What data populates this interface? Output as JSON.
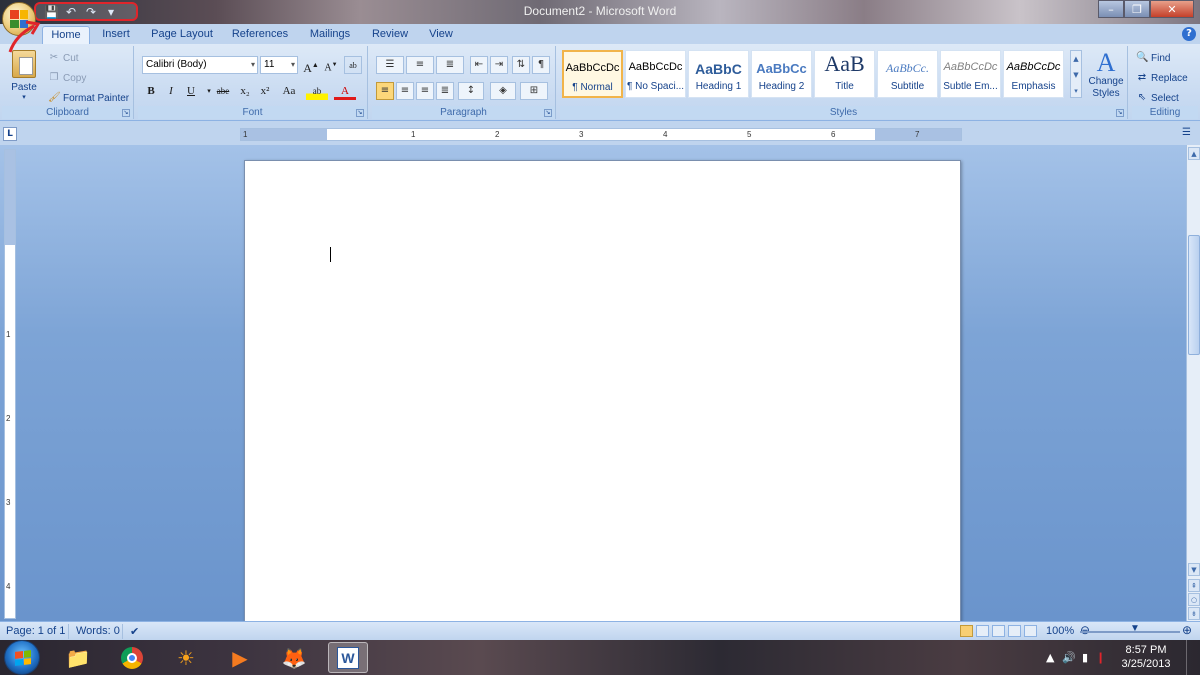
{
  "window": {
    "title": "Document2 - Microsoft Word",
    "minimize_icon": "minimize-icon",
    "maximize_icon": "restore-icon",
    "close_icon": "close-icon"
  },
  "quick_access": {
    "items": [
      "save-icon",
      "undo-icon",
      "redo-icon",
      "customize-dropdown-icon"
    ],
    "highlight_color": "#e0252b"
  },
  "tabs": [
    {
      "label": "Home",
      "active": true
    },
    {
      "label": "Insert"
    },
    {
      "label": "Page Layout"
    },
    {
      "label": "References"
    },
    {
      "label": "Mailings"
    },
    {
      "label": "Review"
    },
    {
      "label": "View"
    }
  ],
  "clipboard": {
    "paste_label": "Paste",
    "cut_label": "Cut",
    "copy_label": "Copy",
    "format_painter_label": "Format Painter",
    "group_label": "Clipboard"
  },
  "font": {
    "family": "Calibri (Body)",
    "size": "11",
    "grow_label": "A",
    "shrink_label": "A",
    "bold": "B",
    "italic": "I",
    "underline": "U",
    "strike": "abe",
    "subscript": "x₂",
    "superscript": "x²",
    "change_case": "Aa",
    "highlight": "ab",
    "font_color": "A",
    "group_label": "Font"
  },
  "paragraph": {
    "group_label": "Paragraph",
    "pilcrow": "¶"
  },
  "styles": {
    "group_label": "Styles",
    "items": [
      {
        "sample": "AaBbCcDc",
        "name": "¶ Normal",
        "selected": true
      },
      {
        "sample": "AaBbCcDc",
        "name": "¶ No Spaci..."
      },
      {
        "sample": "AaBbC",
        "name": "Heading 1"
      },
      {
        "sample": "AaBbCc",
        "name": "Heading 2"
      },
      {
        "sample": "AaB",
        "name": "Title"
      },
      {
        "sample": "AaBbCc.",
        "name": "Subtitle"
      },
      {
        "sample": "AaBbCcDc",
        "name": "Subtle Em..."
      },
      {
        "sample": "AaBbCcDc",
        "name": "Emphasis"
      }
    ],
    "change_styles_label": "Change Styles"
  },
  "editing": {
    "group_label": "Editing",
    "find_label": "Find",
    "replace_label": "Replace",
    "select_label": "Select"
  },
  "ruler": {
    "corner_label": "L",
    "h_numbers": [
      "1",
      "1",
      "2",
      "3",
      "4",
      "5",
      "6",
      "7"
    ],
    "v_numbers": [
      "1",
      "2",
      "3",
      "4"
    ]
  },
  "status": {
    "page": "Page: 1 of 1",
    "words": "Words: 0",
    "zoom": "100%"
  },
  "taskbar": {
    "apps": [
      "explorer-icon",
      "chrome-icon",
      "messenger-icon",
      "media-player-icon",
      "firefox-icon",
      "word-icon"
    ],
    "time": "8:57 PM",
    "date": "3/25/2013"
  }
}
